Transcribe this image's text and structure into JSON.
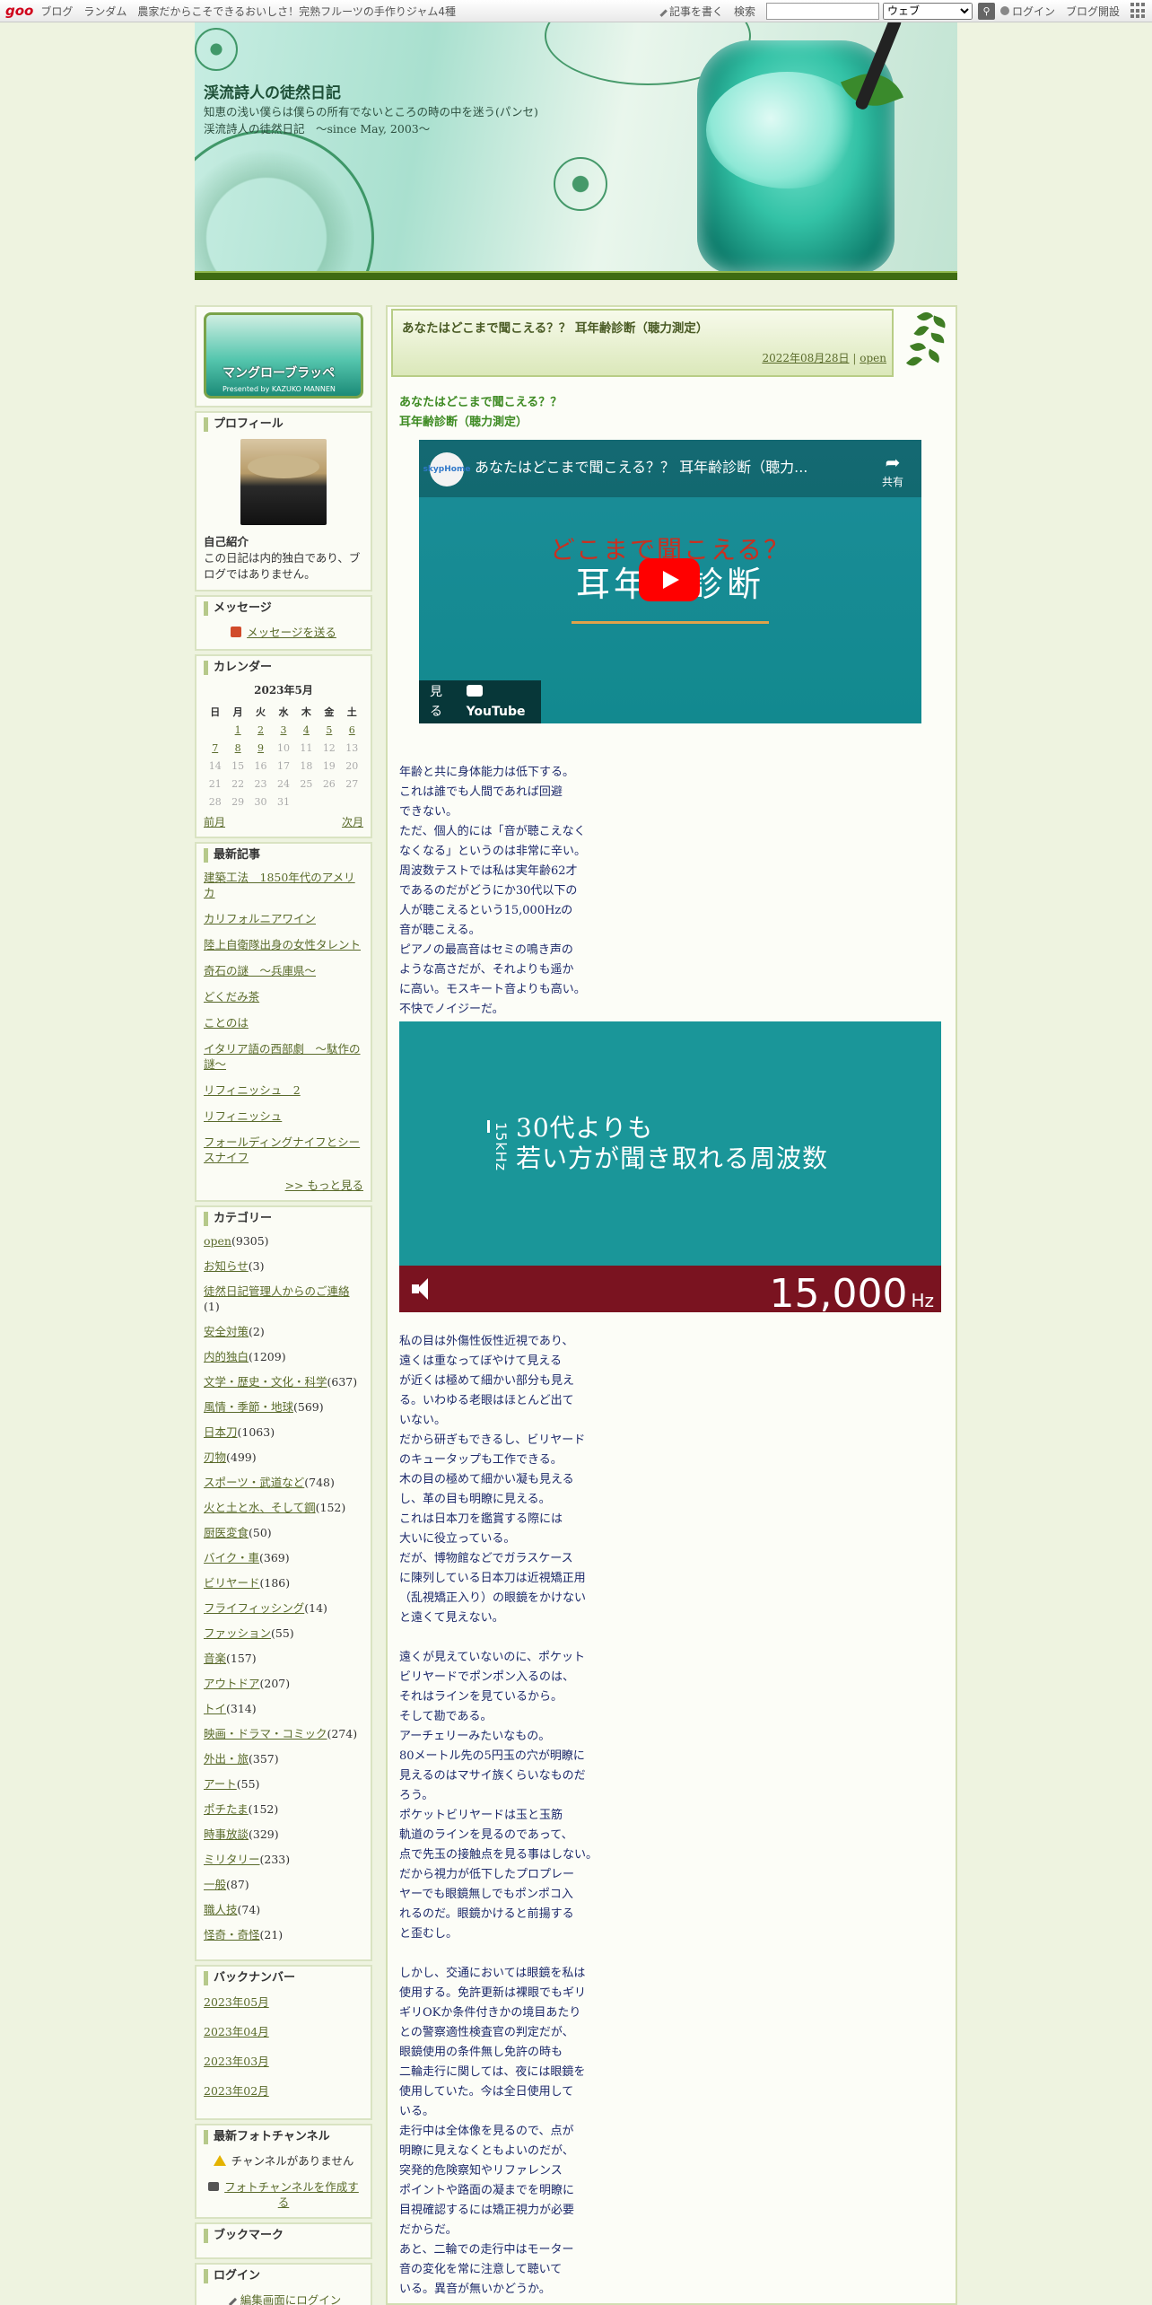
{
  "topbar": {
    "logo": "goo",
    "links": [
      "ブログ",
      "ランダム",
      "農家だからこそできるおいしさ！完熟フルーツの手作りジャム4種"
    ],
    "write": "記事を書く",
    "search_label": "検索",
    "search_placeholder": "",
    "search_scope": "ウェブ",
    "login": "ログイン",
    "open_blog": "ブログ開設"
  },
  "header": {
    "title": "渓流詩人の徒然日記",
    "description": "知恵の浅い僕らは僕らの所有でないところの時の中を迷う(パンセ)　渓流詩人の徒然日記　～since May, 2003～"
  },
  "sidebar": {
    "banner": {
      "line1": "マングローブラッペ",
      "line2": "Presented by KAZUKO MANNEN"
    },
    "profile": {
      "heading": "プロフィール",
      "intro_label": "自己紹介",
      "intro_text": "この日記は内的独白であり、ブログではありません。"
    },
    "message": {
      "heading": "メッセージ",
      "link": "メッセージを送る"
    },
    "calendar": {
      "heading": "カレンダー",
      "month": "2023年5月",
      "weekdays": [
        "日",
        "月",
        "火",
        "水",
        "木",
        "金",
        "土"
      ],
      "weeks": [
        [
          "",
          "1",
          "2",
          "3",
          "4",
          "5",
          "6"
        ],
        [
          "7",
          "8",
          "9",
          "10",
          "11",
          "12",
          "13"
        ],
        [
          "14",
          "15",
          "16",
          "17",
          "18",
          "19",
          "20"
        ],
        [
          "21",
          "22",
          "23",
          "24",
          "25",
          "26",
          "27"
        ],
        [
          "28",
          "29",
          "30",
          "31",
          "",
          "",
          ""
        ]
      ],
      "prev": "前月",
      "next": "次月"
    },
    "recent": {
      "heading": "最新記事",
      "items": [
        "建築工法　1850年代のアメリカ",
        "カリフォルニアワイン",
        "陸上自衛隊出身の女性タレント",
        "奇石の謎　〜兵庫県〜",
        "どくだみ茶",
        "ことのは",
        "イタリア語の西部劇　〜駄作の謎〜",
        "リフィニッシュ　2",
        "リフィニッシュ",
        "フォールディングナイフとシースナイフ"
      ],
      "more": ">> もっと見る"
    },
    "categories": {
      "heading": "カテゴリー",
      "items": [
        {
          "name": "open",
          "count": "(9305)"
        },
        {
          "name": "お知らせ",
          "count": "(3)"
        },
        {
          "name": "徒然日記管理人からのご連絡",
          "count": "(1)"
        },
        {
          "name": "安全対策",
          "count": "(2)"
        },
        {
          "name": "内的独白",
          "count": "(1209)"
        },
        {
          "name": "文学・歴史・文化・科学",
          "count": "(637)"
        },
        {
          "name": "風情・季節・地球",
          "count": "(569)"
        },
        {
          "name": "日本刀",
          "count": "(1063)"
        },
        {
          "name": "刃物",
          "count": "(499)"
        },
        {
          "name": "スポーツ・武道など",
          "count": "(748)"
        },
        {
          "name": "火と土と水、そして鋼",
          "count": "(152)"
        },
        {
          "name": "厨医変食",
          "count": "(50)"
        },
        {
          "name": "バイク・車",
          "count": "(369)"
        },
        {
          "name": "ビリヤード",
          "count": "(186)"
        },
        {
          "name": "フライフィッシング",
          "count": "(14)"
        },
        {
          "name": "ファッション",
          "count": "(55)"
        },
        {
          "name": "音楽",
          "count": "(157)"
        },
        {
          "name": "アウトドア",
          "count": "(207)"
        },
        {
          "name": "トイ",
          "count": "(314)"
        },
        {
          "name": "映画・ドラマ・コミック",
          "count": "(274)"
        },
        {
          "name": "外出・旅",
          "count": "(357)"
        },
        {
          "name": "アート",
          "count": "(55)"
        },
        {
          "name": "ポチたま",
          "count": "(152)"
        },
        {
          "name": "時事放談",
          "count": "(329)"
        },
        {
          "name": "ミリタリー",
          "count": "(233)"
        },
        {
          "name": "一般",
          "count": "(87)"
        },
        {
          "name": "職人技",
          "count": "(74)"
        },
        {
          "name": "怪奇・奇怪",
          "count": "(21)"
        }
      ]
    },
    "backnumber": {
      "heading": "バックナンバー",
      "items": [
        "2023年05月",
        "2023年04月",
        "2023年03月",
        "2023年02月"
      ]
    },
    "photo": {
      "heading": "最新フォトチャンネル",
      "none": "チャンネルがありません",
      "create": "フォトチャンネルを作成する"
    },
    "bookmark": {
      "heading": "ブックマーク"
    },
    "login": {
      "heading": "ログイン",
      "link": "編集画面にログイン"
    }
  },
  "post": {
    "title": "あなたはどこまで聞こえる？？ 耳年齢診断（聴力測定）",
    "date": "2022年08月28日",
    "sep": "|",
    "category": "open",
    "heading_lines": [
      "あなたはどこまで聞こえる？？",
      "耳年齢診断（聴力測定）"
    ],
    "video": {
      "channel": "skypHome",
      "title": "あなたはどこまで聞こえる？？ 耳年齢診断（聴力...",
      "share": "共有",
      "line1": "どこまで聞こえる？",
      "line2": "耳年齢診断",
      "watch": "見る",
      "youtube": "YouTube"
    },
    "para1": [
      "年齢と共に身体能力は低下する。",
      "これは誰でも人間であれば回避",
      "できない。",
      "ただ、個人的には「音が聴こえなく",
      "なくなる」というのは非常に辛い。",
      "周波数テストでは私は実年齢62才",
      "であるのだがどうにか30代以下の",
      "人が聴こえるという15,000Hzの",
      "音が聴こえる。",
      "ピアノの最高音はセミの鳴き声の",
      "ような高さだが、それよりも遥か",
      "に高い。モスキート音よりも高い。",
      "不快でノイジーだ。"
    ],
    "freq_image": {
      "vertical": "15kHz",
      "line1": "30代よりも",
      "line2": "若い方が聞き取れる周波数",
      "value": "15,000",
      "unit": "Hz"
    },
    "para2": [
      "私の目は外傷性仮性近視であり、",
      "遠くは重なってぼやけて見える",
      "が近くは極めて細かい部分も見え",
      "る。いわゆる老眼はほとんど出て",
      "いない。",
      "だから研ぎもできるし、ビリヤード",
      "のキュータップも工作できる。",
      "木の目の極めて細かい凝も見える",
      "し、革の目も明瞭に見える。",
      "これは日本刀を鑑賞する際には",
      "大いに役立っている。",
      "だが、博物館などでガラスケース",
      "に陳列している日本刀は近視矯正用",
      "（乱視矯正入り）の眼鏡をかけない",
      "と遠くて見えない。",
      "",
      "遠くが見えていないのに、ポケット",
      "ビリヤードでポンポン入るのは、",
      "それはラインを見ているから。",
      "そして勘である。",
      "アーチェリーみたいなもの。",
      "80メートル先の5円玉の穴が明瞭に",
      "見えるのはマサイ族くらいなものだ",
      "ろう。",
      "ポケットビリヤードは玉と玉筋",
      "軌道のラインを見るのであって、",
      "点で先玉の接触点を見る事はしない。",
      "だから視力が低下したプロプレー",
      "ヤーでも眼鏡無しでもポンポコ入",
      "れるのだ。眼鏡かけると前揚する",
      "と歪むし。",
      "",
      "しかし、交通においては眼鏡を私は",
      "使用する。免許更新は裸眼でもギリ",
      "ギリOKか条件付きかの境目あたり",
      "との警察適性検査官の判定だが、",
      "眼鏡使用の条件無し免許の時も",
      "二輪走行に関しては、夜には眼鏡を",
      "使用していた。今は全日使用して",
      "いる。",
      "走行中は全体像を見るので、点が",
      "明瞭に見えなくともよいのだが、",
      "突発的危険察知やリファレンス",
      "ポイントや路面の凝までを明瞭に",
      "目視確認するには矯正視力が必要",
      "だからだ。",
      "あと、二輪での走行中はモーター",
      "音の変化を常に注意して聴いて",
      "いる。異音が無いかどうか。"
    ]
  },
  "colors": {
    "accent": "#5a6b2b",
    "post_heading": "#3d8a22",
    "body_text": "#1d2a6b"
  }
}
